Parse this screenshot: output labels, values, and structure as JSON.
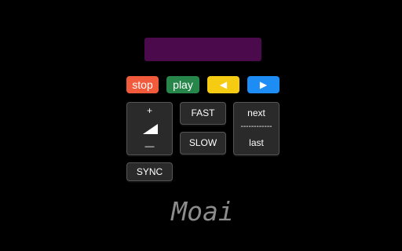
{
  "display": {
    "value": ""
  },
  "controls": {
    "stop_label": "stop",
    "play_label": "play",
    "prev_label": "◀",
    "next_label": "▶"
  },
  "volume": {
    "up_label": "+",
    "down_label": "—"
  },
  "speed": {
    "fast_label": "FAST",
    "slow_label": "SLOW"
  },
  "track": {
    "next_label": "next",
    "divider": "------------",
    "last_label": "last"
  },
  "sync_label": "SYNC",
  "app_name": "Moai",
  "colors": {
    "background": "#000000",
    "display": "#4a0a4c",
    "stop": "#f15a3a",
    "play": "#27874a",
    "prev": "#f6cc12",
    "next": "#1e8cf5",
    "key": "#2a2a2a",
    "brand_text": "#8c8c8c"
  },
  "icons": {
    "volume": "volume-ramp-icon",
    "prev": "triangle-left-icon",
    "next": "triangle-right-icon"
  }
}
